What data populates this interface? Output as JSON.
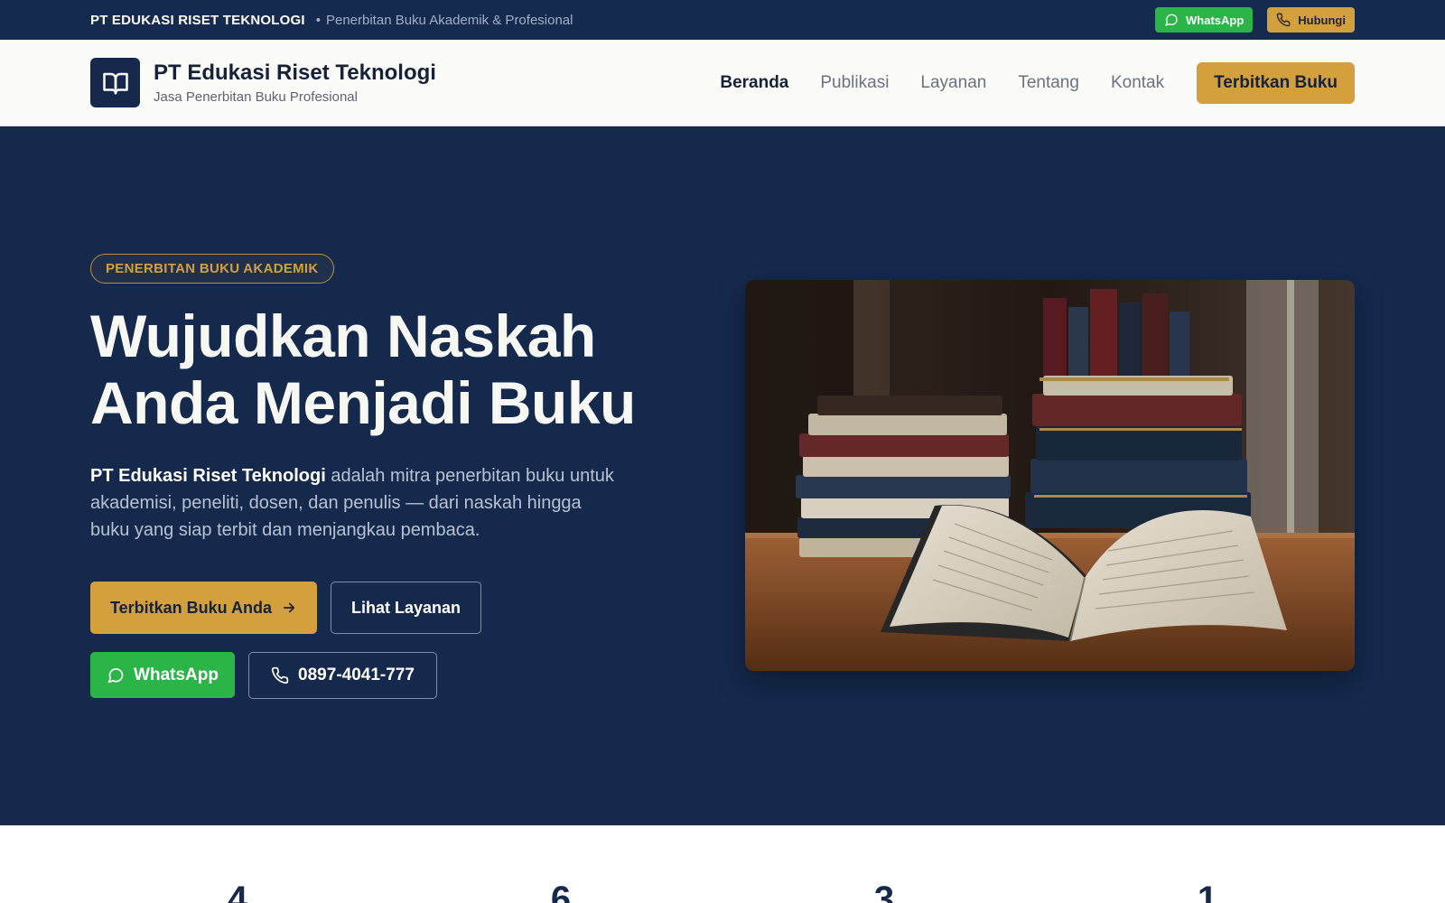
{
  "topbar": {
    "brand": "PT EDUKASI RISET TEKNOLOGI",
    "separator": "•",
    "tagline": "Penerbitan Buku Akademik & Profesional",
    "whatsapp_label": "WhatsApp",
    "call_label": "Hubungi",
    "whatsapp_icon": "whatsapp-icon",
    "phone_icon": "phone-icon"
  },
  "header": {
    "logo_icon": "open-book-icon",
    "title": "PT Edukasi Riset Teknologi",
    "subtitle": "Jasa Penerbitan Buku Profesional",
    "nav": [
      {
        "label": "Beranda",
        "active": true
      },
      {
        "label": "Publikasi",
        "active": false
      },
      {
        "label": "Layanan",
        "active": false
      },
      {
        "label": "Tentang",
        "active": false
      },
      {
        "label": "Kontak",
        "active": false
      }
    ],
    "cta": "Terbitkan Buku"
  },
  "hero": {
    "badge": "PENERBITAN BUKU AKADEMIK",
    "headline_line1": "Wujudkan Naskah",
    "headline_line2": "Anda Menjadi Buku",
    "lead_strong": "PT Edukasi Riset Teknologi",
    "lead_rest": " adalah mitra penerbitan buku untuk akademisi, peneliti, dosen, dan penulis — dari naskah hingga buku yang siap terbit dan menjangkau pembaca.",
    "primary_button": "Terbitkan Buku Anda",
    "secondary_button": "Lihat Layanan",
    "whatsapp_button": "WhatsApp",
    "phone_number": "0897-4041-777",
    "image_subject": "stacked-books-and-open-book"
  },
  "stats": {
    "values": [
      "4",
      "6",
      "3",
      "1"
    ]
  },
  "colors": {
    "navy": "#15294d",
    "gold": "#d4a03d",
    "green": "#2bb548",
    "header_bg": "#fbfbf8"
  }
}
